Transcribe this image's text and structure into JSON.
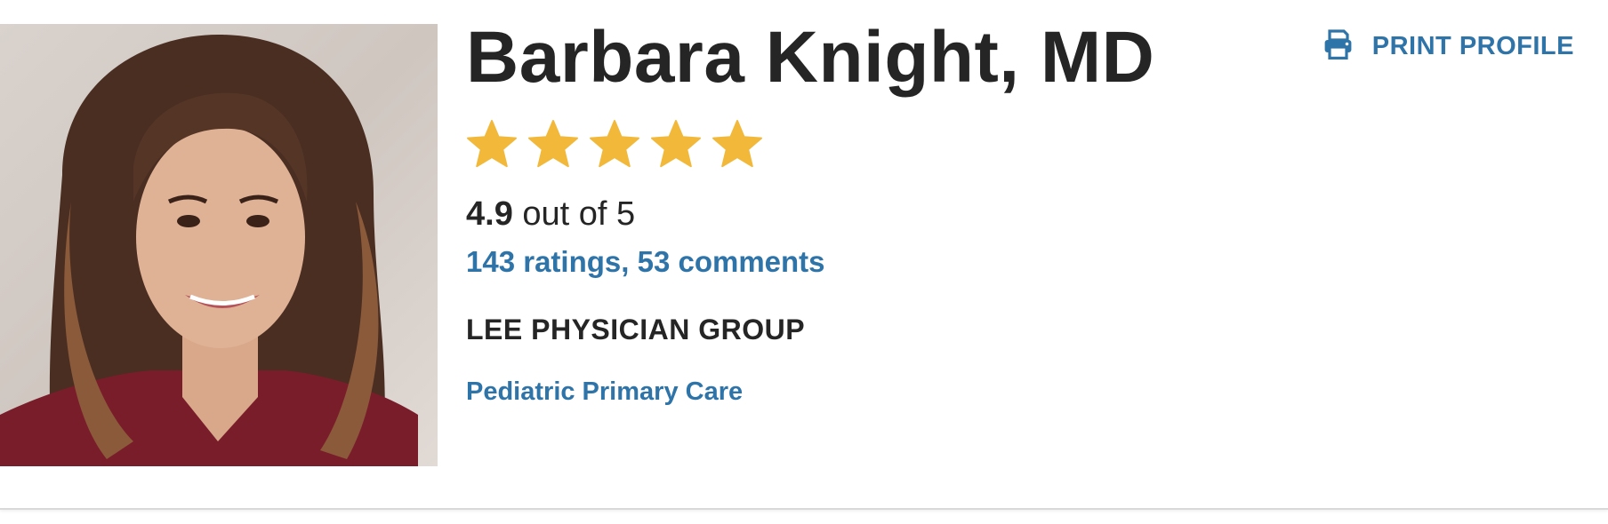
{
  "provider": {
    "name": "Barbara Knight, MD",
    "photo_alt": "Barbara Knight, MD"
  },
  "actions": {
    "print_label": "PRINT PROFILE",
    "print_icon": "printer-icon"
  },
  "rating": {
    "stars_filled": 5,
    "stars_total": 5,
    "score": "4.9",
    "out_of_text": " out of 5",
    "ratings_comments_link": "143 ratings, 53 comments"
  },
  "affiliation": {
    "group": "LEE PHYSICIAN GROUP",
    "specialty": "Pediatric Primary Care"
  },
  "colors": {
    "link_blue": "#2e74a8",
    "star_gold": "#f1b83a",
    "text_dark": "#252525"
  }
}
